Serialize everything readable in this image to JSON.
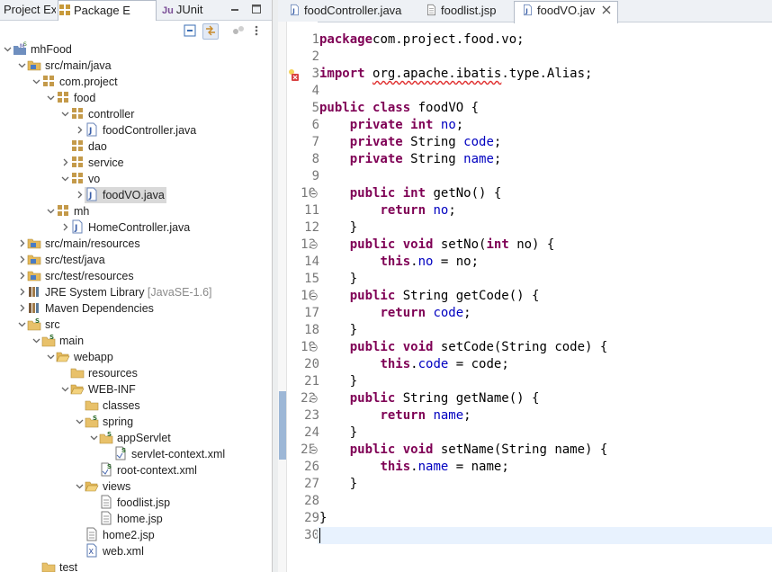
{
  "view_tabs": [
    {
      "label": "Project Ex",
      "icon": "project-explorer-icon"
    },
    {
      "label": "Package E",
      "icon": "package-explorer-icon",
      "active": true
    },
    {
      "label": "JUnit",
      "icon": "junit-icon",
      "badge": "Ju"
    }
  ],
  "toolbar": {
    "collapse_all": "collapse-all-icon",
    "link_editor": "link-with-editor-icon",
    "focus": "focus-icon",
    "menu": "view-menu-icon"
  },
  "tree": [
    {
      "depth": 0,
      "arrow": "down",
      "icon": "project-icon",
      "label": "mhFood"
    },
    {
      "depth": 1,
      "arrow": "down",
      "icon": "source-folder-icon",
      "label": "src/main/java"
    },
    {
      "depth": 2,
      "arrow": "down",
      "icon": "package-icon",
      "label": "com.project"
    },
    {
      "depth": 3,
      "arrow": "down",
      "icon": "package-icon",
      "label": "food"
    },
    {
      "depth": 4,
      "arrow": "down",
      "icon": "package-icon",
      "label": "controller"
    },
    {
      "depth": 5,
      "arrow": "right",
      "icon": "java-file-icon",
      "label": "foodController.java"
    },
    {
      "depth": 4,
      "arrow": "",
      "icon": "package-icon",
      "label": "dao"
    },
    {
      "depth": 4,
      "arrow": "right",
      "icon": "package-icon",
      "label": "service"
    },
    {
      "depth": 4,
      "arrow": "down",
      "icon": "package-icon",
      "label": "vo"
    },
    {
      "depth": 5,
      "arrow": "right",
      "icon": "java-file-icon",
      "label": "foodVO.java",
      "selected": true
    },
    {
      "depth": 3,
      "arrow": "down",
      "icon": "package-icon",
      "label": "mh"
    },
    {
      "depth": 4,
      "arrow": "right",
      "icon": "java-file-icon",
      "label": "HomeController.java"
    },
    {
      "depth": 1,
      "arrow": "right",
      "icon": "source-folder-icon",
      "label": "src/main/resources"
    },
    {
      "depth": 1,
      "arrow": "right",
      "icon": "source-folder-icon",
      "label": "src/test/java"
    },
    {
      "depth": 1,
      "arrow": "right",
      "icon": "source-folder-icon",
      "label": "src/test/resources"
    },
    {
      "depth": 1,
      "arrow": "right",
      "icon": "library-icon",
      "label": "JRE System Library",
      "decor": "[JavaSE-1.6]"
    },
    {
      "depth": 1,
      "arrow": "right",
      "icon": "library-icon",
      "label": "Maven Dependencies"
    },
    {
      "depth": 1,
      "arrow": "down",
      "icon": "spring-folder-icon",
      "label": "src"
    },
    {
      "depth": 2,
      "arrow": "down",
      "icon": "spring-folder-icon",
      "label": "main"
    },
    {
      "depth": 3,
      "arrow": "down",
      "icon": "open-folder-icon",
      "label": "webapp"
    },
    {
      "depth": 4,
      "arrow": "",
      "icon": "folder-icon",
      "label": "resources"
    },
    {
      "depth": 4,
      "arrow": "down",
      "icon": "open-folder-icon",
      "label": "WEB-INF"
    },
    {
      "depth": 5,
      "arrow": "",
      "icon": "folder-icon",
      "label": "classes"
    },
    {
      "depth": 5,
      "arrow": "down",
      "icon": "spring-folder-icon",
      "label": "spring"
    },
    {
      "depth": 6,
      "arrow": "down",
      "icon": "spring-folder-icon",
      "label": "appServlet"
    },
    {
      "depth": 7,
      "arrow": "",
      "icon": "spring-xml-icon",
      "label": "servlet-context.xml"
    },
    {
      "depth": 6,
      "arrow": "",
      "icon": "spring-xml-icon",
      "label": "root-context.xml"
    },
    {
      "depth": 5,
      "arrow": "down",
      "icon": "open-folder-icon",
      "label": "views"
    },
    {
      "depth": 6,
      "arrow": "",
      "icon": "jsp-file-icon",
      "label": "foodlist.jsp"
    },
    {
      "depth": 6,
      "arrow": "",
      "icon": "jsp-file-icon",
      "label": "home.jsp"
    },
    {
      "depth": 5,
      "arrow": "",
      "icon": "jsp-file-icon",
      "label": "home2.jsp"
    },
    {
      "depth": 5,
      "arrow": "",
      "icon": "xml-file-icon",
      "label": "web.xml"
    },
    {
      "depth": 2,
      "arrow": "",
      "icon": "folder-icon",
      "label": "test"
    }
  ],
  "editor_tabs": [
    {
      "label": "foodController.java",
      "icon": "java-file-icon"
    },
    {
      "label": "foodlist.jsp",
      "icon": "jsp-file-icon"
    },
    {
      "label": "foodVO.jav",
      "icon": "java-file-icon",
      "active": true
    }
  ],
  "code": [
    {
      "n": "1",
      "t": [
        [
          "kw",
          "package"
        ],
        [
          "",
          "com.project.food.vo;"
        ]
      ]
    },
    {
      "n": "2",
      "t": []
    },
    {
      "n": "3",
      "t": [
        [
          "kw",
          "import"
        ],
        [
          "",
          " "
        ],
        [
          "err",
          "org.apache.ibatis"
        ],
        [
          "",
          ".type.Alias;"
        ]
      ],
      "marker": "error-marker-icon"
    },
    {
      "n": "4",
      "t": []
    },
    {
      "n": "5",
      "t": [
        [
          "kw",
          "public"
        ],
        [
          "",
          " "
        ],
        [
          "kw",
          "class"
        ],
        [
          "",
          " foodVO {"
        ]
      ]
    },
    {
      "n": "6",
      "t": [
        [
          "",
          "    "
        ],
        [
          "kw",
          "private"
        ],
        [
          "",
          " "
        ],
        [
          "kw",
          "int"
        ],
        [
          "",
          " "
        ],
        [
          "fld",
          "no"
        ],
        [
          "",
          ";"
        ]
      ]
    },
    {
      "n": "7",
      "t": [
        [
          "",
          "    "
        ],
        [
          "kw",
          "private"
        ],
        [
          "",
          " String "
        ],
        [
          "fld",
          "code"
        ],
        [
          "",
          ";"
        ]
      ]
    },
    {
      "n": "8",
      "t": [
        [
          "",
          "    "
        ],
        [
          "kw",
          "private"
        ],
        [
          "",
          " String "
        ],
        [
          "fld",
          "name"
        ],
        [
          "",
          ";"
        ]
      ]
    },
    {
      "n": "9",
      "t": []
    },
    {
      "n": "10",
      "fold": true,
      "t": [
        [
          "",
          "    "
        ],
        [
          "kw",
          "public"
        ],
        [
          "",
          " "
        ],
        [
          "kw",
          "int"
        ],
        [
          "",
          " getNo() {"
        ]
      ]
    },
    {
      "n": "11",
      "t": [
        [
          "",
          "        "
        ],
        [
          "kw",
          "return"
        ],
        [
          "",
          " "
        ],
        [
          "fld",
          "no"
        ],
        [
          "",
          ";"
        ]
      ]
    },
    {
      "n": "12",
      "t": [
        [
          "",
          "    }"
        ]
      ]
    },
    {
      "n": "13",
      "fold": true,
      "t": [
        [
          "",
          "    "
        ],
        [
          "kw",
          "public"
        ],
        [
          "",
          " "
        ],
        [
          "kw",
          "void"
        ],
        [
          "",
          " setNo("
        ],
        [
          "kw",
          "int"
        ],
        [
          "",
          " no) {"
        ]
      ]
    },
    {
      "n": "14",
      "t": [
        [
          "",
          "        "
        ],
        [
          "kw",
          "this"
        ],
        [
          "",
          "."
        ],
        [
          "fld",
          "no"
        ],
        [
          "",
          " = no;"
        ]
      ]
    },
    {
      "n": "15",
      "t": [
        [
          "",
          "    }"
        ]
      ]
    },
    {
      "n": "16",
      "fold": true,
      "t": [
        [
          "",
          "    "
        ],
        [
          "kw",
          "public"
        ],
        [
          "",
          " String getCode() {"
        ]
      ]
    },
    {
      "n": "17",
      "t": [
        [
          "",
          "        "
        ],
        [
          "kw",
          "return"
        ],
        [
          "",
          " "
        ],
        [
          "fld",
          "code"
        ],
        [
          "",
          ";"
        ]
      ]
    },
    {
      "n": "18",
      "t": [
        [
          "",
          "    }"
        ]
      ]
    },
    {
      "n": "19",
      "fold": true,
      "t": [
        [
          "",
          "    "
        ],
        [
          "kw",
          "public"
        ],
        [
          "",
          " "
        ],
        [
          "kw",
          "void"
        ],
        [
          "",
          " setCode(String code) {"
        ]
      ]
    },
    {
      "n": "20",
      "t": [
        [
          "",
          "        "
        ],
        [
          "kw",
          "this"
        ],
        [
          "",
          "."
        ],
        [
          "fld",
          "code"
        ],
        [
          "",
          " = code;"
        ]
      ]
    },
    {
      "n": "21",
      "t": [
        [
          "",
          "    }"
        ]
      ]
    },
    {
      "n": "22",
      "fold": true,
      "t": [
        [
          "",
          "    "
        ],
        [
          "kw",
          "public"
        ],
        [
          "",
          " String getName() {"
        ]
      ]
    },
    {
      "n": "23",
      "t": [
        [
          "",
          "        "
        ],
        [
          "kw",
          "return"
        ],
        [
          "",
          " "
        ],
        [
          "fld",
          "name"
        ],
        [
          "",
          ";"
        ]
      ]
    },
    {
      "n": "24",
      "t": [
        [
          "",
          "    }"
        ]
      ]
    },
    {
      "n": "25",
      "fold": true,
      "t": [
        [
          "",
          "    "
        ],
        [
          "kw",
          "public"
        ],
        [
          "",
          " "
        ],
        [
          "kw",
          "void"
        ],
        [
          "",
          " setName(String name) {"
        ]
      ]
    },
    {
      "n": "26",
      "t": [
        [
          "",
          "        "
        ],
        [
          "kw",
          "this"
        ],
        [
          "",
          "."
        ],
        [
          "fld",
          "name"
        ],
        [
          "",
          " = name;"
        ]
      ]
    },
    {
      "n": "27",
      "t": [
        [
          "",
          "    }"
        ]
      ]
    },
    {
      "n": "28",
      "t": []
    },
    {
      "n": "29",
      "t": [
        [
          "",
          "}"
        ]
      ]
    },
    {
      "n": "30",
      "t": [],
      "current": true
    }
  ],
  "colors": {
    "keyword": "#7f0055",
    "field": "#0000c0",
    "selection": "#d9d9d9",
    "current_line": "#e8f2fe"
  }
}
